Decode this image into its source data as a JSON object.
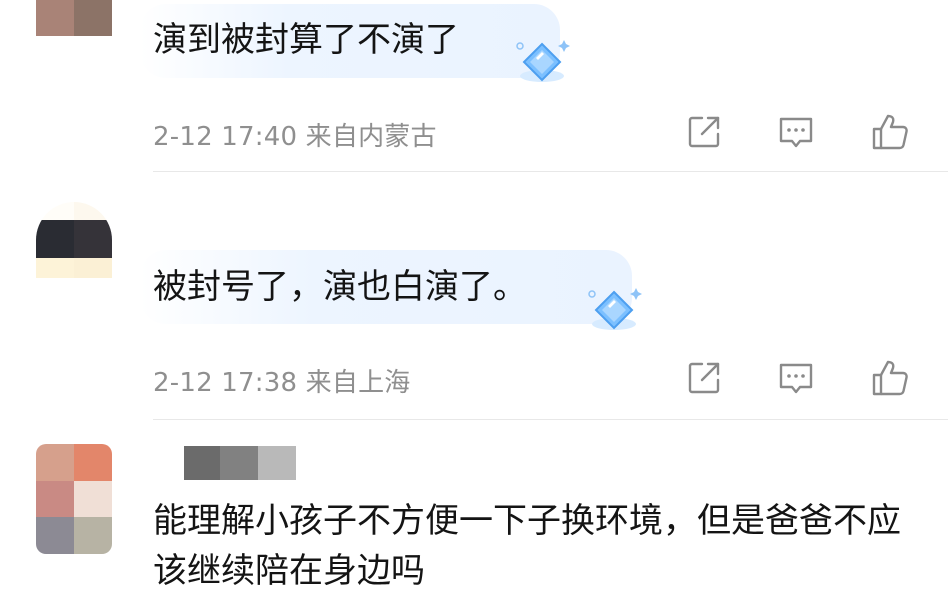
{
  "comments": [
    {
      "text": "演到被封算了不演了",
      "time": "2-12 17:40",
      "location": "来自内蒙古"
    },
    {
      "text": "被封号了，演也白演了。",
      "time": "2-12 17:38",
      "location": "来自上海"
    },
    {
      "text": "能理解小孩子不方便一下子换环境，但是爸爸不应该继续陪在身边吗"
    }
  ],
  "icons": {
    "share": "share-icon",
    "reply": "comment-icon",
    "like": "thumbs-up-icon",
    "badge": "diamond-badge-icon"
  },
  "colors": {
    "bubble": "#eaf3ff",
    "badge": "#5aa9f5",
    "meta_text": "#8f8f8f",
    "icon_gray": "#8a8a8a"
  }
}
